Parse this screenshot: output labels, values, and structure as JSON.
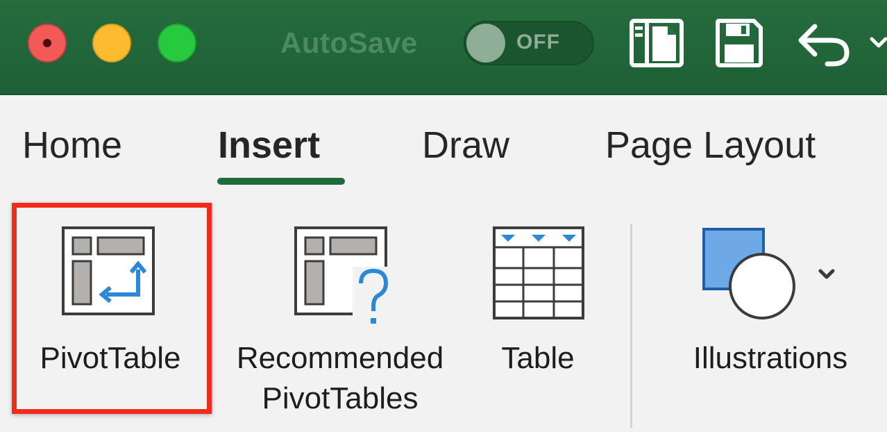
{
  "window": {
    "controls": {
      "close": "close-button",
      "minimize": "minimize-button",
      "zoom": "zoom-button"
    },
    "autosave": {
      "label": "AutoSave",
      "state": "OFF"
    },
    "quick_access": [
      {
        "icon": "sidebar-document-icon"
      },
      {
        "icon": "save-icon"
      },
      {
        "icon": "undo-icon"
      },
      {
        "icon": "chevron-down-icon"
      }
    ]
  },
  "ribbon": {
    "tabs": [
      {
        "label": "Home"
      },
      {
        "label": "Insert",
        "active": true
      },
      {
        "label": "Draw"
      },
      {
        "label": "Page Layout"
      }
    ],
    "buttons": {
      "pivottable": {
        "label": "PivotTable",
        "highlighted": true
      },
      "recommended": {
        "line1": "Recommended",
        "line2": "PivotTables"
      },
      "table": {
        "label": "Table"
      },
      "illustrations": {
        "label": "Illustrations"
      }
    }
  },
  "colors": {
    "titlebar": "#256d3d",
    "accent": "#1f6b3b",
    "highlight": "#f02b1b",
    "icon_blue": "#2b88d8"
  }
}
